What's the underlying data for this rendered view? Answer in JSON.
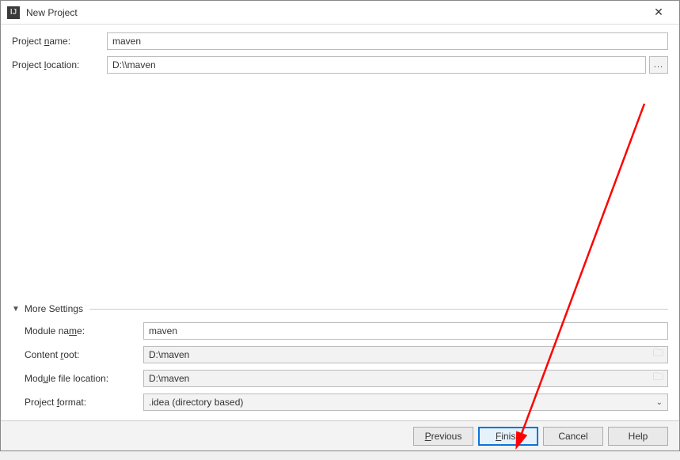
{
  "window": {
    "title": "New Project"
  },
  "fields": {
    "project_name": {
      "label_pre": "Project ",
      "label_u": "n",
      "label_post": "ame:",
      "value": "maven"
    },
    "project_location": {
      "label_pre": "Project ",
      "label_u": "l",
      "label_post": "ocation:",
      "value": "D:\\\\maven",
      "browse": "..."
    }
  },
  "more_settings": {
    "title": "More Settings",
    "module_name": {
      "label_pre": "Module na",
      "label_u": "m",
      "label_post": "e:",
      "value": "maven"
    },
    "content_root": {
      "label_pre": "Content ",
      "label_u": "r",
      "label_post": "oot:",
      "value": "D:\\maven"
    },
    "module_file_location": {
      "label_pre": "Mod",
      "label_u": "u",
      "label_post": "le file location:",
      "value": "D:\\maven"
    },
    "project_format": {
      "label_pre": "Project ",
      "label_u": "f",
      "label_post": "ormat:",
      "value": ".idea (directory based)"
    }
  },
  "buttons": {
    "previous_u": "P",
    "previous_rest": "revious",
    "finish_u": "F",
    "finish_rest": "inish",
    "cancel": "Cancel",
    "help": "Help"
  }
}
